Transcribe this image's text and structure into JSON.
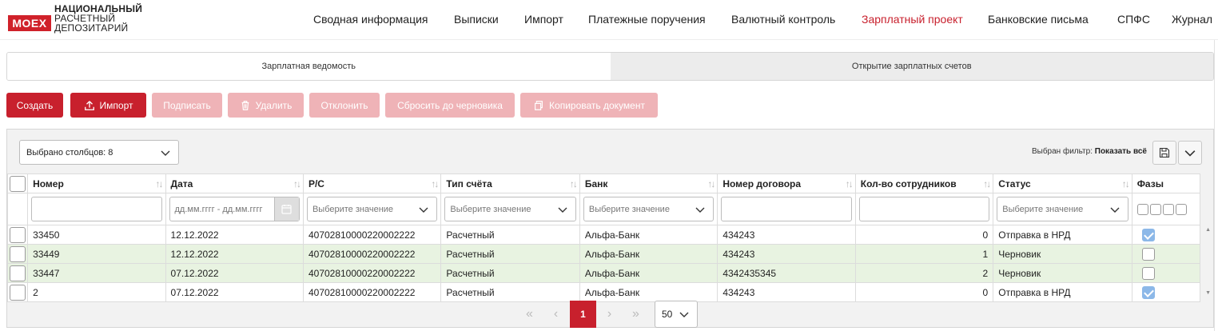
{
  "logo": {
    "box": "MOEX",
    "line1": "НАЦИОНАЛЬНЫЙ",
    "line2": "РАСЧЕТНЫЙ",
    "line3": "ДЕПОЗИТАРИЙ"
  },
  "nav": [
    {
      "label": "Сводная информация",
      "active": false
    },
    {
      "label": "Выписки",
      "active": false
    },
    {
      "label": "Импорт",
      "active": false
    },
    {
      "label": "Платежные поручения",
      "active": false
    },
    {
      "label": "Валютный контроль",
      "active": false
    },
    {
      "label": "Зарплатный проект",
      "active": true
    },
    {
      "label": "Банковские письма",
      "active": false
    },
    {
      "label": "СПФС",
      "active": false
    },
    {
      "label": "Журнал",
      "active": false
    }
  ],
  "tabs": [
    {
      "label": "Зарплатная ведомость",
      "active": true
    },
    {
      "label": "Открытие зарплатных счетов",
      "active": false
    }
  ],
  "toolbar": {
    "create": "Создать",
    "import": "Импорт",
    "sign": "Подписать",
    "delete": "Удалить",
    "reject": "Отклонить",
    "reset": "Сбросить до черновика",
    "copy": "Копировать документ"
  },
  "grid": {
    "columns_selected": "Выбрано столбцов: 8",
    "filter_prefix": "Выбран фильтр:",
    "filter_value": "Показать всё",
    "columns": [
      "Номер",
      "Дата",
      "Р/С",
      "Тип счёта",
      "Банк",
      "Номер договора",
      "Кол-во сотрудников",
      "Статус",
      "Фазы"
    ],
    "filters": {
      "date_placeholder": "дд.мм.гггг - дд.мм.гггг",
      "select_placeholder": "Выберите значение"
    },
    "rows": [
      {
        "number": "33450",
        "date": "12.12.2022",
        "account": "40702810000220002222",
        "type": "Расчетный",
        "bank": "Альфа-Банк",
        "contract": "434243",
        "employees": "0",
        "status": "Отправка в НРД",
        "phase_checked": true,
        "highlight": false
      },
      {
        "number": "33449",
        "date": "12.12.2022",
        "account": "40702810000220002222",
        "type": "Расчетный",
        "bank": "Альфа-Банк",
        "contract": "434243",
        "employees": "1",
        "status": "Черновик",
        "phase_checked": false,
        "highlight": true
      },
      {
        "number": "33447",
        "date": "07.12.2022",
        "account": "40702810000220002222",
        "type": "Расчетный",
        "bank": "Альфа-Банк",
        "contract": "4342435345",
        "employees": "2",
        "status": "Черновик",
        "phase_checked": false,
        "highlight": true
      },
      {
        "number": "2",
        "date": "07.12.2022",
        "account": "40702810000220002222",
        "type": "Расчетный",
        "bank": "Альфа-Банк",
        "contract": "434243",
        "employees": "0",
        "status": "Отправка в НРД",
        "phase_checked": true,
        "highlight": false
      }
    ]
  },
  "pager": {
    "first": "«",
    "prev": "‹",
    "current": "1",
    "next": "›",
    "last": "»",
    "page_size": "50"
  },
  "colors": {
    "accent": "#c8202d",
    "disabled": "#efb3b7",
    "highlight_row": "#e8f3e1"
  }
}
